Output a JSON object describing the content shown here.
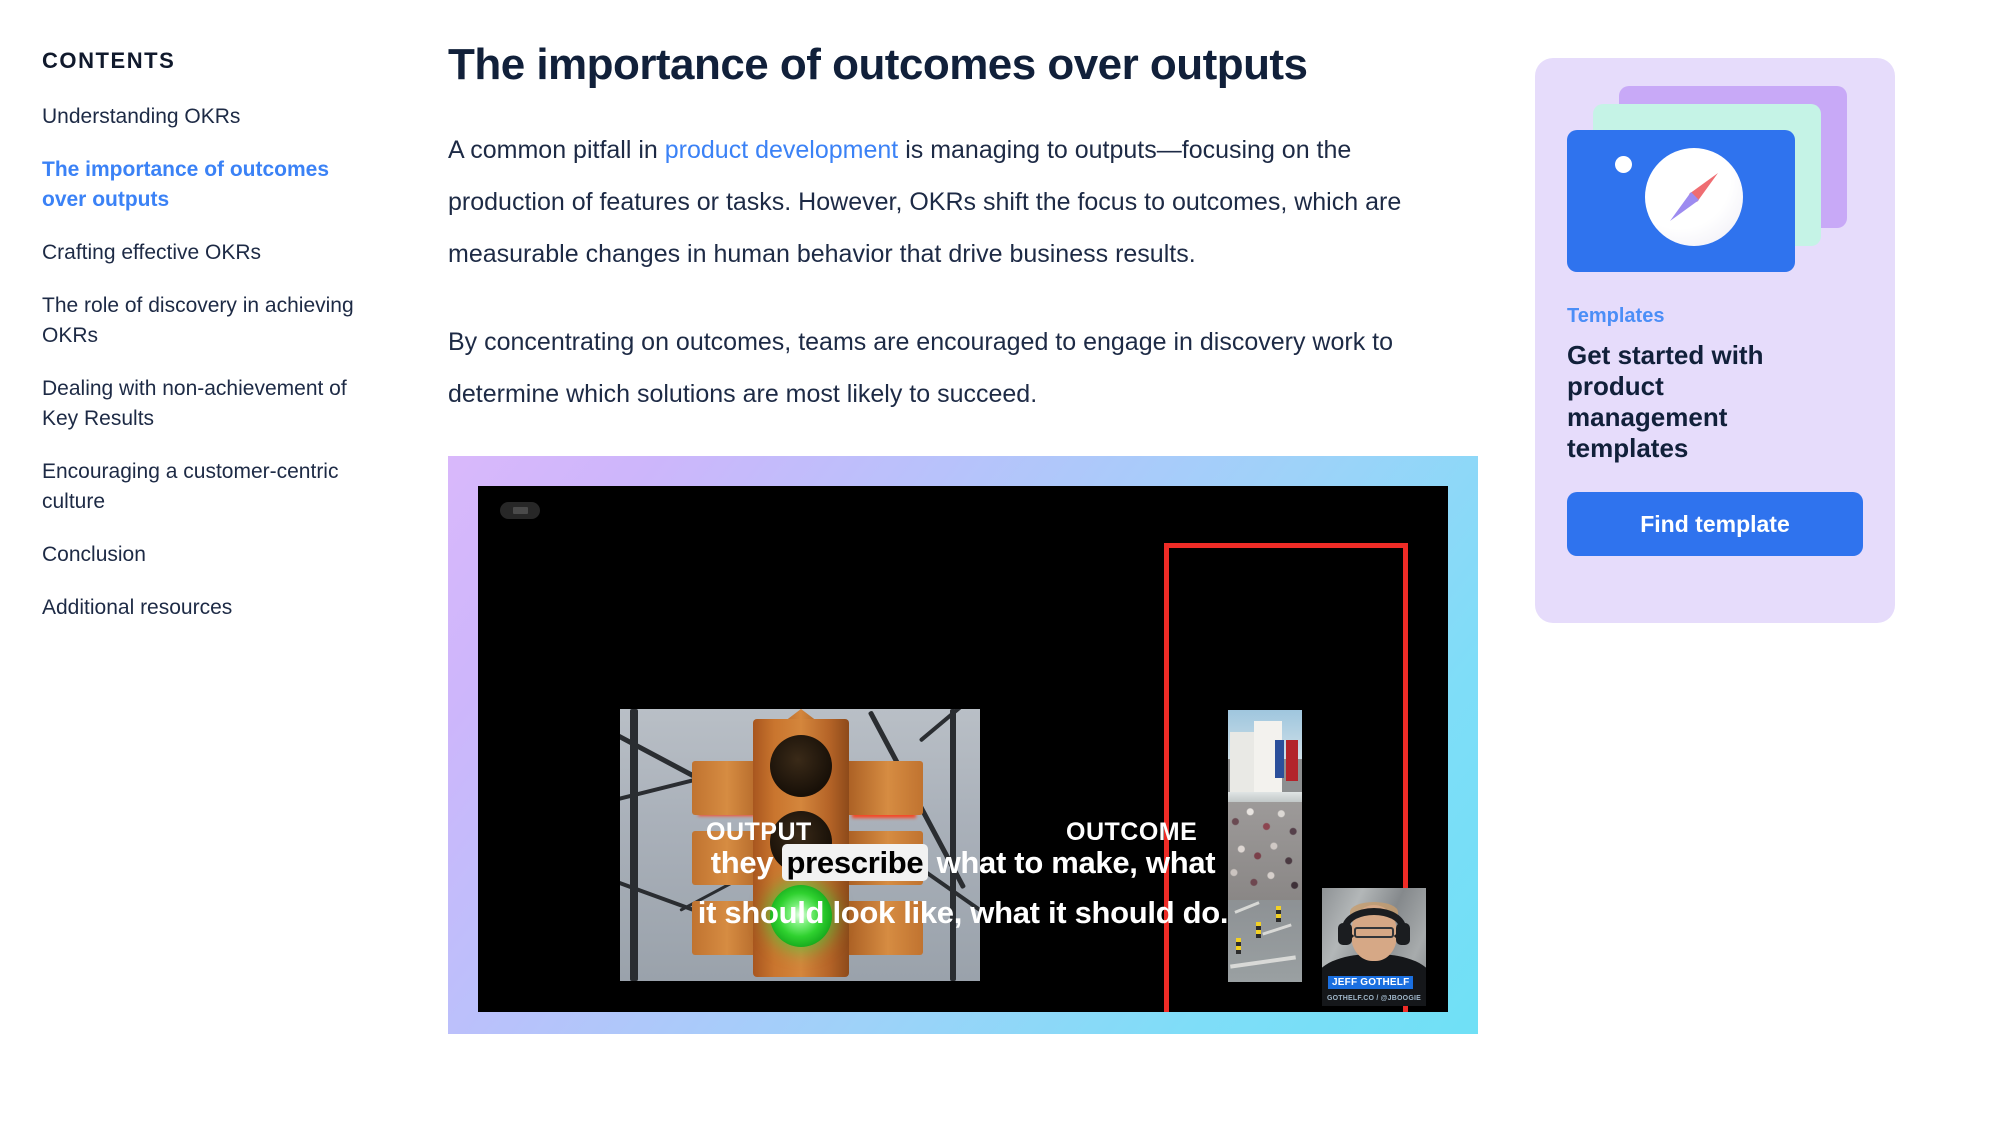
{
  "toc": {
    "title": "CONTENTS",
    "items": [
      {
        "label": "Understanding OKRs",
        "active": false
      },
      {
        "label": "The importance of outcomes over outputs",
        "active": true
      },
      {
        "label": "Crafting effective OKRs",
        "active": false
      },
      {
        "label": "The role of discovery in achieving OKRs",
        "active": false
      },
      {
        "label": "Dealing with non-achievement of Key Results",
        "active": false
      },
      {
        "label": "Encouraging a customer-centric culture",
        "active": false
      },
      {
        "label": "Conclusion",
        "active": false
      },
      {
        "label": "Additional resources",
        "active": false
      }
    ]
  },
  "article": {
    "heading": "The importance of outcomes over outputs",
    "para1_before": "A common pitfall in ",
    "para1_link": "product development",
    "para1_after": " is managing to outputs—focusing on the production of features or tasks. However, OKRs shift the focus to outcomes, which are measurable changes in human behavior that drive business results.",
    "para2": "By concentrating on outcomes, teams are encouraged to engage in discovery work to determine which solutions are most likely to succeed."
  },
  "video": {
    "label_output": "OUTPUT",
    "label_outcome": "OUTCOME",
    "caption_line1_a": "they ",
    "caption_line1_highlight": "prescribe",
    "caption_line1_b": " what to make, what",
    "caption_line2": "it should look like, what it should do.",
    "speaker_name": "JEFF GOTHELF",
    "speaker_handle": "GOTHELF.CO / @JBOOGIE"
  },
  "promo": {
    "eyebrow": "Templates",
    "title": "Get started with product management templates",
    "button_label": "Find template"
  },
  "colors": {
    "accent_blue": "#3b82f6",
    "brand_blue": "#2f73ee",
    "text_dark": "#1d2a45",
    "promo_bg": "#e6dcfb",
    "frame_red": "#ee2b26"
  }
}
